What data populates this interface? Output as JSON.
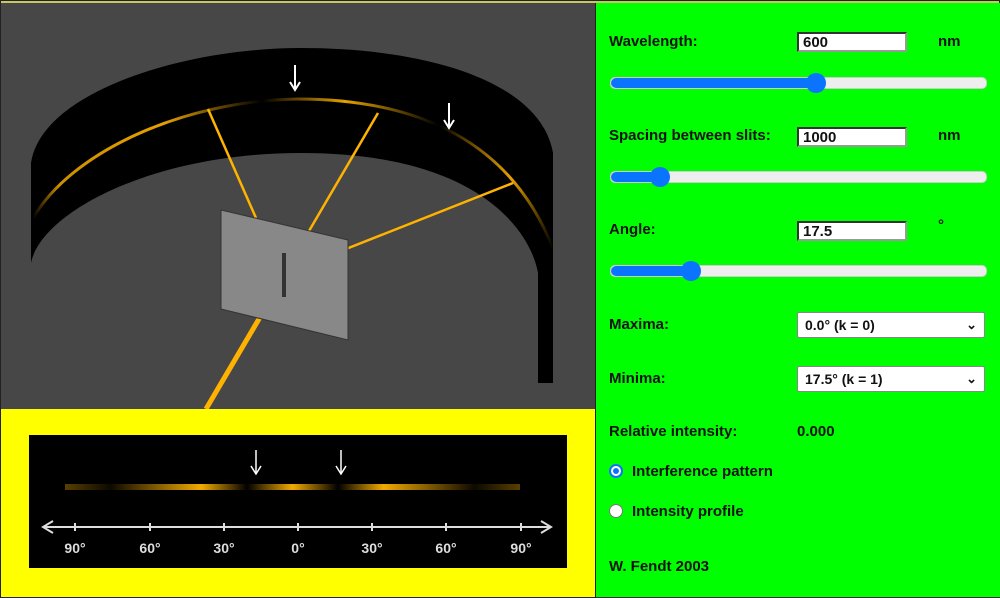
{
  "scene": {
    "colors": {
      "background": "#474747",
      "screen": "#000000",
      "light": "#ffb300",
      "slit_plate": "#888888"
    },
    "arrow_icons": [
      "arrow-down-icon",
      "arrow-down-icon"
    ]
  },
  "pattern": {
    "axis_labels": [
      "90°",
      "60°",
      "30°",
      "0°",
      "30°",
      "60°",
      "90°"
    ],
    "background": "#ffff00"
  },
  "panel": {
    "background": "#00ff00",
    "wavelength": {
      "label": "Wavelength:",
      "value": "600",
      "unit": "nm",
      "slider_fraction": 0.547
    },
    "spacing": {
      "label": "Spacing between slits:",
      "value": "1000",
      "unit": "nm",
      "slider_fraction": 0.13
    },
    "angle": {
      "label": "Angle:",
      "value": "17.5",
      "unit": "°",
      "slider_fraction": 0.213
    },
    "maxima": {
      "label": "Maxima:",
      "selected": "0.0° (k = 0)"
    },
    "minima": {
      "label": "Minima:",
      "selected": "17.5° (k = 1)"
    },
    "intensity": {
      "label": "Relative intensity:",
      "value": "0.000"
    },
    "radio_pattern": {
      "label": "Interference pattern",
      "checked": true
    },
    "radio_profile": {
      "label": "Intensity profile",
      "checked": false
    },
    "author": "W. Fendt 2003"
  }
}
